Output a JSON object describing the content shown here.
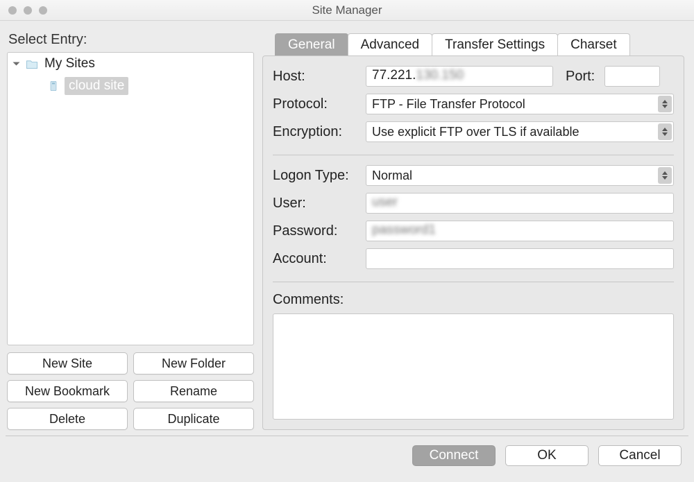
{
  "window": {
    "title": "Site Manager",
    "select_entry_label": "Select Entry:"
  },
  "tree": {
    "root_label": "My Sites",
    "child_label": "cloud site"
  },
  "left_buttons": {
    "new_site": "New Site",
    "new_folder": "New Folder",
    "new_bookmark": "New Bookmark",
    "rename": "Rename",
    "delete": "Delete",
    "duplicate": "Duplicate"
  },
  "tabs": {
    "general": "General",
    "advanced": "Advanced",
    "transfer": "Transfer Settings",
    "charset": "Charset"
  },
  "form": {
    "host_label": "Host:",
    "host_value": "77.221.▮▮▮.▮▮",
    "port_label": "Port:",
    "port_value": "",
    "protocol_label": "Protocol:",
    "protocol_value": "FTP - File Transfer Protocol",
    "encryption_label": "Encryption:",
    "encryption_value": "Use explicit FTP over TLS if available",
    "logon_label": "Logon Type:",
    "logon_value": "Normal",
    "user_label": "User:",
    "user_value": "▮▮▮",
    "password_label": "Password:",
    "password_value": "▮▮▮▮▮▮",
    "account_label": "Account:",
    "account_value": "",
    "comments_label": "Comments:",
    "comments_value": ""
  },
  "footer": {
    "connect": "Connect",
    "ok": "OK",
    "cancel": "Cancel"
  }
}
